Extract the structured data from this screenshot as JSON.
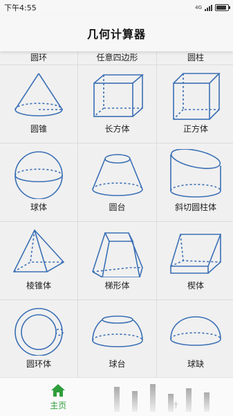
{
  "status_bar": {
    "time": "下午4:55",
    "network": "4G",
    "battery_level": 0.9
  },
  "header": {
    "title": "几何计算器"
  },
  "grid": {
    "partial_row": [
      "圆环",
      "任意四边形",
      "圆柱"
    ],
    "items": [
      {
        "label": "圆锥",
        "icon": "cone-icon"
      },
      {
        "label": "长方体",
        "icon": "cuboid-icon"
      },
      {
        "label": "正方体",
        "icon": "cube-icon"
      },
      {
        "label": "球体",
        "icon": "sphere-icon"
      },
      {
        "label": "圆台",
        "icon": "frustum-icon"
      },
      {
        "label": "斜切圆柱体",
        "icon": "oblique-cylinder-icon"
      },
      {
        "label": "棱锥体",
        "icon": "pyramid-icon"
      },
      {
        "label": "梯形体",
        "icon": "prismatoid-icon"
      },
      {
        "label": "楔体",
        "icon": "wedge-icon"
      },
      {
        "label": "圆环体",
        "icon": "torus-icon"
      },
      {
        "label": "球台",
        "icon": "spherical-frustum-icon"
      },
      {
        "label": "球缺",
        "icon": "spherical-cap-icon"
      }
    ]
  },
  "bottom_nav": {
    "home_label": "主页",
    "second_label": "计",
    "accent_color": "#2e9e3a",
    "shape_stroke_color": "#3a6fb5"
  }
}
